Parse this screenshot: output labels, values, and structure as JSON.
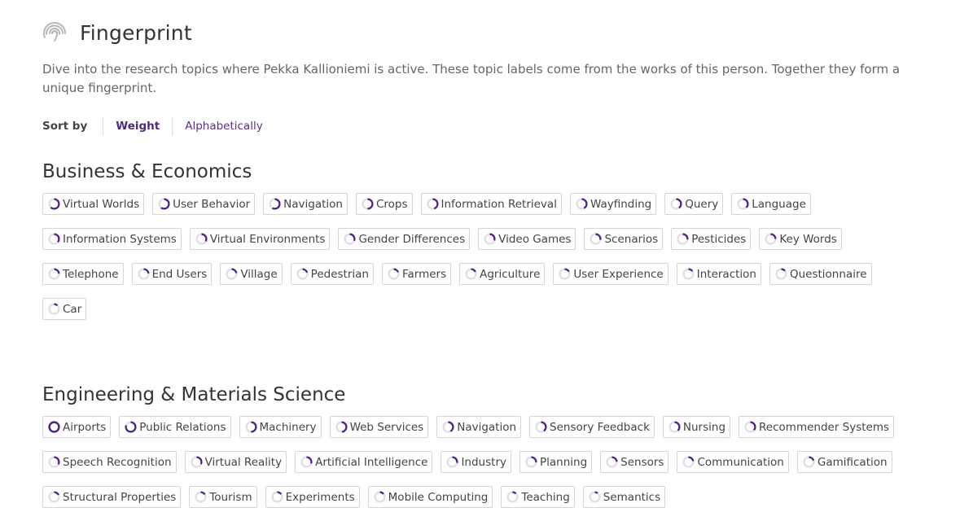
{
  "header": {
    "title": "Fingerprint",
    "icon": "fingerprint-icon",
    "description": "Dive into the research topics where Pekka Kallioniemi is active. These topic labels come from the works of this person. Together they form a unique fingerprint."
  },
  "sort": {
    "label": "Sort by",
    "options": [
      "Weight",
      "Alphabetically"
    ],
    "active": "Weight"
  },
  "colors": {
    "accent": "#4f1f8f",
    "ring_track": "#e0dde6",
    "link": "#5b2e8e"
  },
  "categories": [
    {
      "title": "Business & Economics",
      "topics": [
        {
          "label": "Virtual Worlds",
          "weight": 0.62
        },
        {
          "label": "User Behavior",
          "weight": 0.6
        },
        {
          "label": "Navigation",
          "weight": 0.58
        },
        {
          "label": "Crops",
          "weight": 0.5
        },
        {
          "label": "Information Retrieval",
          "weight": 0.45
        },
        {
          "label": "Wayfinding",
          "weight": 0.42
        },
        {
          "label": "Query",
          "weight": 0.4
        },
        {
          "label": "Language",
          "weight": 0.38
        },
        {
          "label": "Information Systems",
          "weight": 0.36
        },
        {
          "label": "Virtual Environments",
          "weight": 0.33
        },
        {
          "label": "Gender Differences",
          "weight": 0.31
        },
        {
          "label": "Video Games",
          "weight": 0.3
        },
        {
          "label": "Scenarios",
          "weight": 0.28
        },
        {
          "label": "Pesticides",
          "weight": 0.27
        },
        {
          "label": "Key Words",
          "weight": 0.25
        },
        {
          "label": "Telephone",
          "weight": 0.24
        },
        {
          "label": "End Users",
          "weight": 0.23
        },
        {
          "label": "Village",
          "weight": 0.22
        },
        {
          "label": "Pedestrian",
          "weight": 0.2
        },
        {
          "label": "Farmers",
          "weight": 0.19
        },
        {
          "label": "Agriculture",
          "weight": 0.18
        },
        {
          "label": "User Experience",
          "weight": 0.17
        },
        {
          "label": "Interaction",
          "weight": 0.15
        },
        {
          "label": "Questionnaire",
          "weight": 0.14
        },
        {
          "label": "Car",
          "weight": 0.12
        }
      ]
    },
    {
      "title": "Engineering & Materials Science",
      "topics": [
        {
          "label": "Airports",
          "weight": 1.0
        },
        {
          "label": "Public Relations",
          "weight": 0.8
        },
        {
          "label": "Machinery",
          "weight": 0.5
        },
        {
          "label": "Web Services",
          "weight": 0.48
        },
        {
          "label": "Navigation",
          "weight": 0.42
        },
        {
          "label": "Sensory Feedback",
          "weight": 0.4
        },
        {
          "label": "Nursing",
          "weight": 0.38
        },
        {
          "label": "Recommender Systems",
          "weight": 0.36
        },
        {
          "label": "Speech Recognition",
          "weight": 0.33
        },
        {
          "label": "Virtual Reality",
          "weight": 0.32
        },
        {
          "label": "Artificial Intelligence",
          "weight": 0.3
        },
        {
          "label": "Industry",
          "weight": 0.28
        },
        {
          "label": "Planning",
          "weight": 0.26
        },
        {
          "label": "Sensors",
          "weight": 0.24
        },
        {
          "label": "Communication",
          "weight": 0.22
        },
        {
          "label": "Gamification",
          "weight": 0.2
        },
        {
          "label": "Structural Properties",
          "weight": 0.18
        },
        {
          "label": "Tourism",
          "weight": 0.16
        },
        {
          "label": "Experiments",
          "weight": 0.15
        },
        {
          "label": "Mobile Computing",
          "weight": 0.14
        },
        {
          "label": "Teaching",
          "weight": 0.12
        },
        {
          "label": "Semantics",
          "weight": 0.1
        }
      ]
    }
  ]
}
